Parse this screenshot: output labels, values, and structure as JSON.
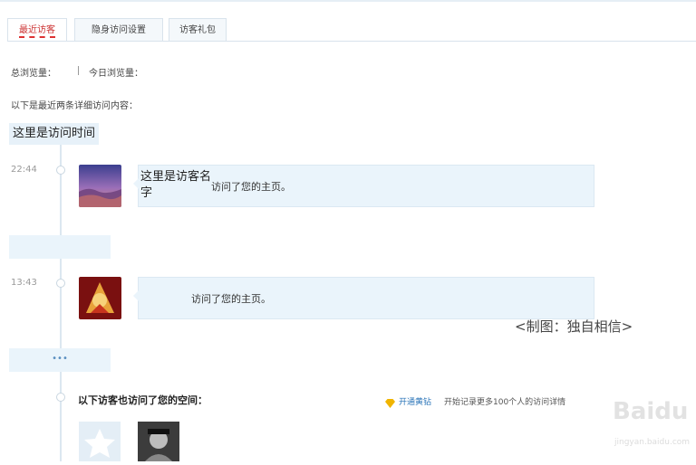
{
  "tabs": [
    {
      "label": "最近访客"
    },
    {
      "label": "隐身访问设置"
    },
    {
      "label": "访客礼包"
    }
  ],
  "stats": {
    "total_label": "总浏览量：",
    "today_label": "今日浏览量："
  },
  "intro": "以下是最近两条详细访问内容：",
  "time_header": "这里是访问时间",
  "entries": [
    {
      "time": "22:44",
      "name": "这里是访客名字",
      "action": "访问了您的主页。"
    },
    {
      "time": "13:43",
      "name": "",
      "action": "访问了您的主页。"
    }
  ],
  "more_dots": "•••",
  "caption": "<制图：独自相信>",
  "also_visited": "以下访客也访问了您的空间：",
  "vip": {
    "link": "开通黄钻",
    "desc": "开始记录更多100个人的访问详情"
  },
  "watermark": {
    "brand": "Baidu",
    "sub": "jingyan.baidu.com"
  },
  "colors": {
    "accent": "#2a74b8",
    "active_tab": "#cc3333",
    "bubble": "#eaf4fb"
  }
}
